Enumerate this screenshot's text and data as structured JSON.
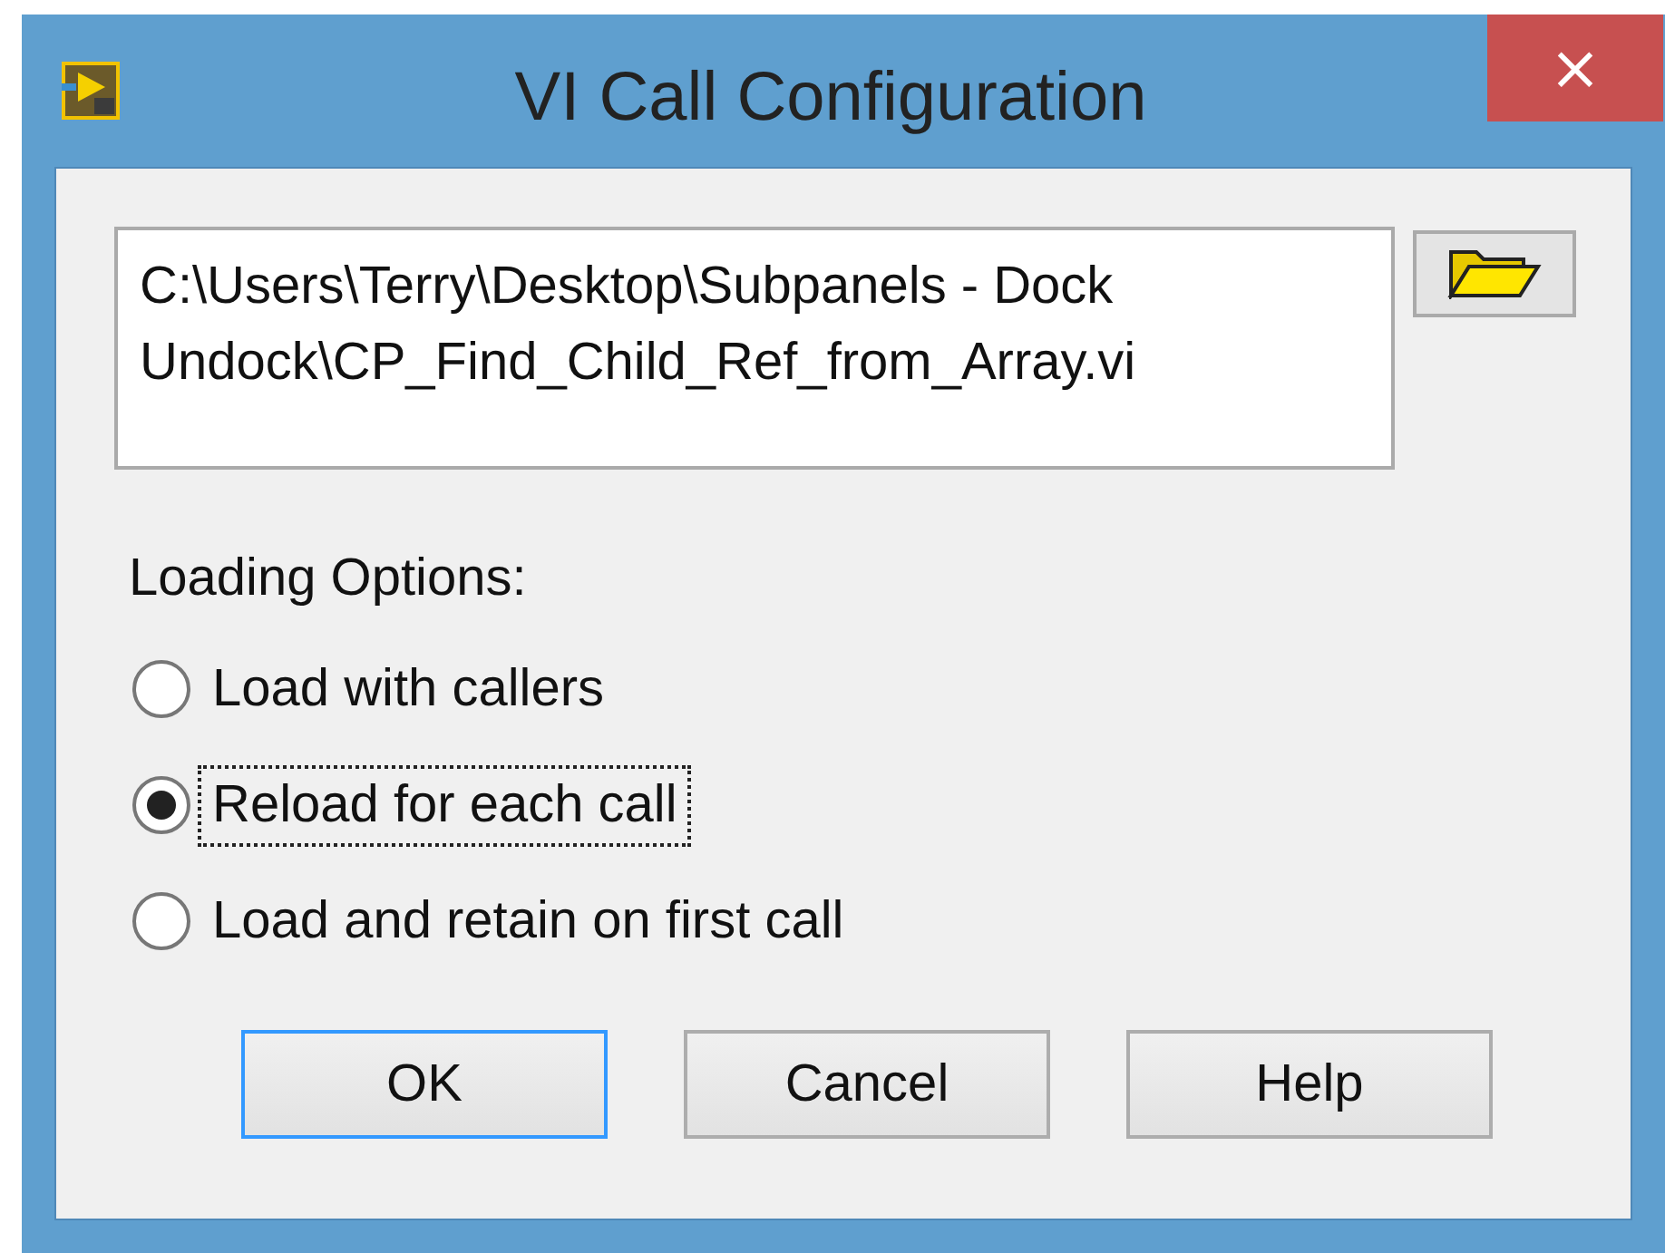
{
  "window": {
    "title": "VI Call Configuration",
    "close": "×"
  },
  "path": {
    "value": "C:\\Users\\Terry\\Desktop\\Subpanels - Dock Undock\\CP_Find_Child_Ref_from_Array.vi"
  },
  "loading_options": {
    "label": "Loading Options:",
    "options": [
      {
        "label": "Load with callers",
        "selected": false
      },
      {
        "label": "Reload for each call",
        "selected": true
      },
      {
        "label": "Load and retain on first call",
        "selected": false
      }
    ]
  },
  "buttons": [
    {
      "label": "OK",
      "default": true
    },
    {
      "label": "Cancel",
      "default": false
    },
    {
      "label": "Help",
      "default": false
    }
  ]
}
